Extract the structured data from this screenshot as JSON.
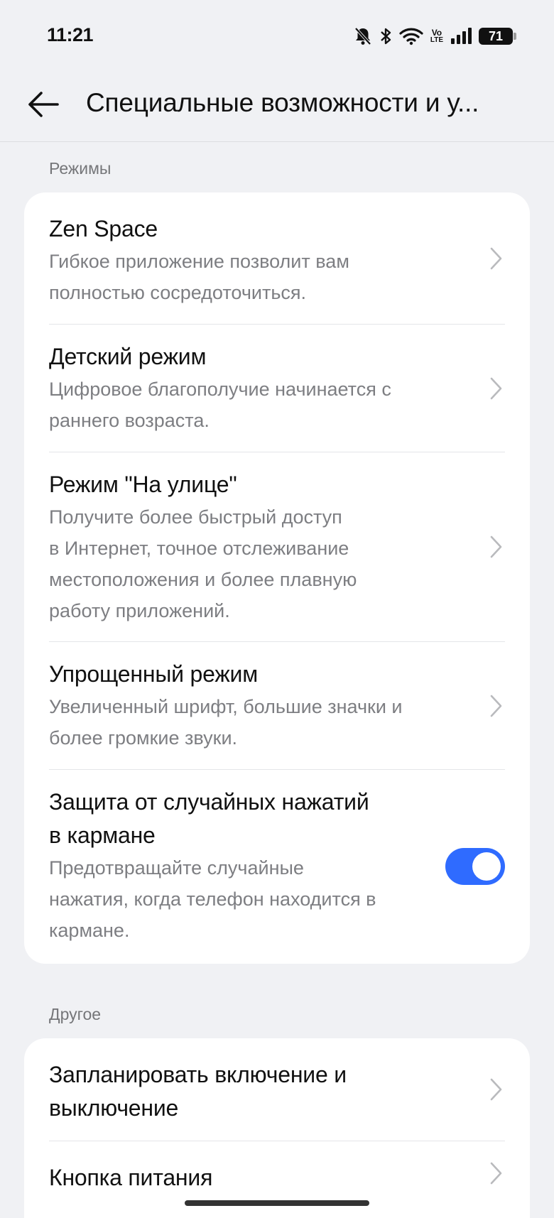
{
  "status_bar": {
    "time": "11:21",
    "battery": "71",
    "volte_top": "Vo",
    "volte_bottom": "LTE",
    "icons": [
      "bell-muted-icon",
      "bluetooth-icon",
      "wifi-icon",
      "volte-icon",
      "signal-icon",
      "battery-icon"
    ]
  },
  "app_bar": {
    "back_icon": "arrow-left-icon",
    "title": "Специальные возможности и у..."
  },
  "sections": [
    {
      "label": "Режимы",
      "items": [
        {
          "title": "Zen Space",
          "desc": [
            "Гибкое приложение позволит вам",
            "полностью сосредоточиться."
          ],
          "control": "chevron"
        },
        {
          "title": "Детский режим",
          "desc": [
            "Цифровое благополучие начинается с",
            "раннего возраста."
          ],
          "control": "chevron"
        },
        {
          "title": "Режим \"На улице\"",
          "desc": [
            "Получите более быстрый доступ",
            "в Интернет, точное отслеживание",
            "местоположения и более плавную",
            "работу приложений."
          ],
          "control": "chevron"
        },
        {
          "title": "Упрощенный режим",
          "desc": [
            "Увеличенный шрифт, большие значки и",
            "более громкие звуки."
          ],
          "control": "chevron"
        },
        {
          "title_lines": [
            "Защита от случайных нажатий",
            "в кармане"
          ],
          "desc": [
            "Предотвращайте случайные",
            "нажатия, когда телефон находится в",
            "кармане."
          ],
          "control": "toggle",
          "toggle_on": true
        }
      ]
    },
    {
      "label": "Другое",
      "items": [
        {
          "title_lines": [
            "Запланировать включение и",
            "выключение"
          ],
          "control": "chevron"
        },
        {
          "title": "Кнопка питания",
          "control": "chevron"
        }
      ]
    }
  ],
  "colors": {
    "background": "#f0f1f4",
    "card": "#ffffff",
    "accent": "#2f6bff",
    "secondary_text": "#7d7e82"
  }
}
